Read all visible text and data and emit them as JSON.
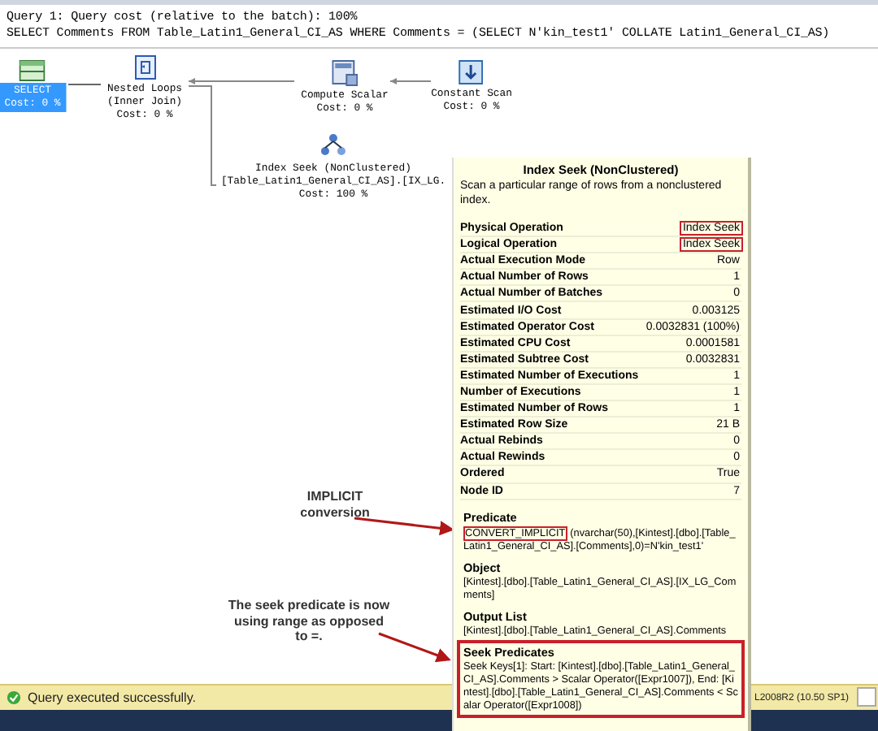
{
  "header": {
    "cost_line": "Query 1: Query cost (relative to the batch): 100%",
    "query": "SELECT Comments FROM Table_Latin1_General_CI_AS WHERE Comments = (SELECT N'kin_test1' COLLATE Latin1_General_CI_AS)"
  },
  "plan": {
    "nodes": [
      {
        "kind": "select",
        "lines": [
          "SELECT",
          "Cost: 0 %"
        ],
        "selected": true
      },
      {
        "kind": "nested_loops",
        "lines": [
          "Nested Loops",
          "(Inner Join)",
          "Cost: 0 %"
        ],
        "selected": false
      },
      {
        "kind": "compute_scalar",
        "lines": [
          "Compute Scalar",
          "Cost: 0 %"
        ],
        "selected": false
      },
      {
        "kind": "constant_scan",
        "lines": [
          "Constant Scan",
          "Cost: 0 %"
        ],
        "selected": false
      },
      {
        "kind": "index_seek",
        "lines": [
          "Index Seek (NonClustered)",
          "[Table_Latin1_General_CI_AS].[IX_LG.",
          "Cost: 100 %"
        ],
        "selected": false
      }
    ]
  },
  "annotations": [
    {
      "text": "IMPLICIT conversion"
    },
    {
      "text": "The seek predicate is now using range as opposed to =."
    }
  ],
  "tooltip": {
    "title": "Index Seek (NonClustered)",
    "description": "Scan a particular range of rows from a nonclustered index.",
    "properties": [
      {
        "label": "Physical Operation",
        "value": "Index Seek",
        "highlighted": true
      },
      {
        "label": "Logical Operation",
        "value": "Index Seek",
        "highlighted": true
      },
      {
        "label": "Actual Execution Mode",
        "value": "Row",
        "highlighted": false
      },
      {
        "label": "Actual Number of Rows",
        "value": "1",
        "highlighted": false
      },
      {
        "label": "Actual Number of Batches",
        "value": "0",
        "highlighted": false
      },
      {
        "label": "Estimated I/O Cost",
        "value": "0.003125",
        "highlighted": false
      },
      {
        "label": "Estimated Operator Cost",
        "value": "0.0032831 (100%)",
        "highlighted": false
      },
      {
        "label": "Estimated CPU Cost",
        "value": "0.0001581",
        "highlighted": false
      },
      {
        "label": "Estimated Subtree Cost",
        "value": "0.0032831",
        "highlighted": false
      },
      {
        "label": "Estimated Number of Executions",
        "value": "1",
        "highlighted": false
      },
      {
        "label": "Number of Executions",
        "value": "1",
        "highlighted": false
      },
      {
        "label": "Estimated Number of Rows",
        "value": "1",
        "highlighted": false
      },
      {
        "label": "Estimated Row Size",
        "value": "21 B",
        "highlighted": false
      },
      {
        "label": "Actual Rebinds",
        "value": "0",
        "highlighted": false
      },
      {
        "label": "Actual Rewinds",
        "value": "0",
        "highlighted": false
      },
      {
        "label": "Ordered",
        "value": "True",
        "highlighted": false
      },
      {
        "label": "Node ID",
        "value": "7",
        "highlighted": false
      }
    ],
    "sections": [
      {
        "heading": "Predicate",
        "highlight": "CONVERT_IMPLICIT",
        "text": "(nvarchar(50),[Kintest].[dbo].[Table_Latin1_General_CI_AS].[Comments],0)=N'kin_test1'",
        "highlighted": false
      },
      {
        "heading": "Object",
        "text": "[Kintest].[dbo].[Table_Latin1_General_CI_AS].[IX_LG_Comments]",
        "highlighted": false
      },
      {
        "heading": "Output List",
        "text": "[Kintest].[dbo].[Table_Latin1_General_CI_AS].Comments",
        "highlighted": false
      },
      {
        "heading": "Seek Predicates",
        "text": "Seek Keys[1]: Start: [Kintest].[dbo].[Table_Latin1_General_CI_AS].Comments > Scalar Operator([Expr1007]), End: [Kintest].[dbo].[Table_Latin1_General_CI_AS].Comments < Scalar Operator([Expr1008])",
        "highlighted": true
      }
    ]
  },
  "status_bar": {
    "message": "Query executed successfully.",
    "server": "L2008R2 (10.50 SP1)"
  }
}
